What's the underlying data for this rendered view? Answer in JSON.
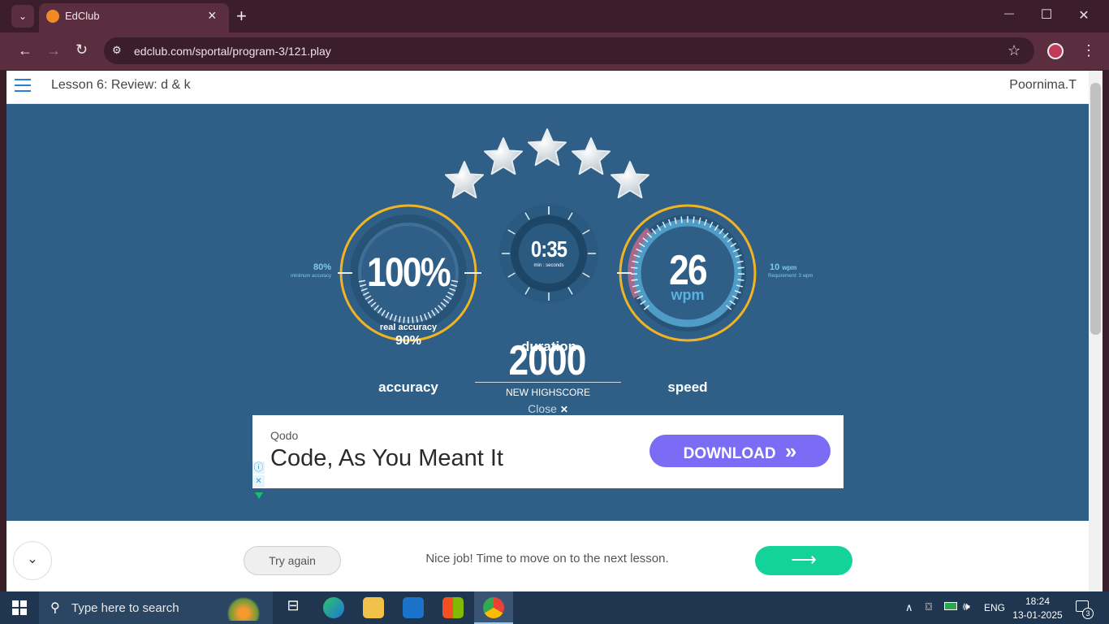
{
  "browser": {
    "tab_title": "EdClub",
    "url": "edclub.com/sportal/program-3/121.play",
    "new_tab": "+",
    "tab_close": "×",
    "minimize": "—",
    "maximize": "☐",
    "close": "✕"
  },
  "header": {
    "lesson_title": "Lesson 6: Review: d & k",
    "user_name": "Poornima.T"
  },
  "results": {
    "stars_earned": 5,
    "accuracy": {
      "value": "100%",
      "real_label": "real accuracy",
      "real_value": "90%",
      "label": "accuracy",
      "min_value": "80%",
      "min_label": "minimum accuracy"
    },
    "duration": {
      "value": "0:35",
      "unit": "min : seconds",
      "label": "duration"
    },
    "speed": {
      "value": "26",
      "unit": "wpm",
      "label": "speed",
      "req_value": "10",
      "req_unit": "wpm",
      "req_label": "Requirement: 3 wpm"
    },
    "score": "2000",
    "score_label": "NEW HIGHSCORE",
    "close_label": "Close",
    "close_icon": "✕"
  },
  "ad": {
    "brand": "Qodo",
    "headline": "Code, As You Meant It",
    "cta": "DOWNLOAD",
    "cta_icon": "»",
    "info_icon": "ⓘ",
    "close_icon": "✕"
  },
  "footer": {
    "try_again": "Try again",
    "message": "Nice job! Time to move on to the next lesson.",
    "next_icon": "⟶",
    "collapse_icon": "⌄"
  },
  "taskbar": {
    "search_placeholder": "Type here to search",
    "lang": "ENG",
    "time": "18:24",
    "date": "13-01-2025",
    "notifications": "3"
  },
  "colors": {
    "blue_bg": "#2f5f87",
    "gold": "#f0b323",
    "cta": "#7b6cf6",
    "next": "#14d39a"
  }
}
